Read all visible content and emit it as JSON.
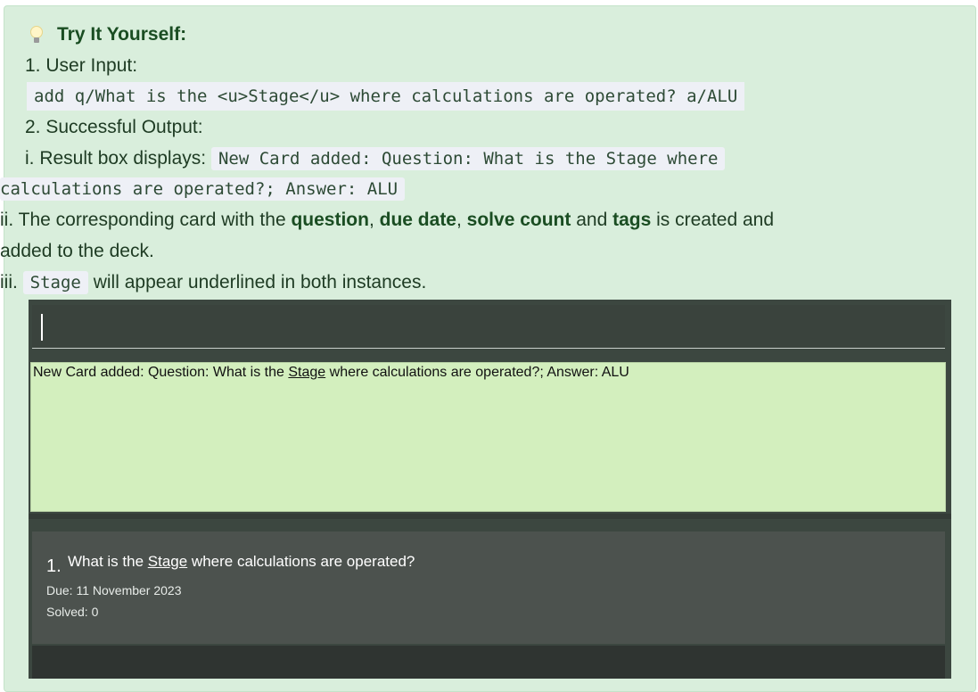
{
  "callout": {
    "title": "Try It Yourself:",
    "icon": "lightbulb-icon",
    "step1_label": "1. User Input:",
    "user_input": "add q/What is the <u>Stage</u> where calculations are operated? a/ALU",
    "step2_label": "2. Successful Output:",
    "step2_i_prefix": "i. Result box displays: ",
    "result_code_part1": "New Card added: Question: What is the Stage where",
    "result_code_part2": "calculations are operated?; Answer: ALU",
    "step2_ii_pre": "ii. The corresponding card with the ",
    "bold_question": "question",
    "comma1": ", ",
    "bold_due_date": "due date",
    "comma2": ", ",
    "bold_solve_count": "solve count",
    "and_word": " and ",
    "bold_tags": "tags",
    "step2_ii_post": " is created and",
    "step2_ii_line2": "added to the deck.",
    "step2_iii_prefix": "iii. ",
    "stage_code": "Stage",
    "step2_iii_suffix": " will appear underlined in both instances."
  },
  "app": {
    "result_prefix": "New Card added: Question: What is the ",
    "result_underlined": "Stage",
    "result_suffix": " where calculations are operated?; Answer: ALU",
    "card": {
      "index": "1.",
      "question_prefix": "What is the ",
      "question_underlined": "Stage",
      "question_suffix": " where calculations are operated?",
      "due": "Due: 11 November 2023",
      "solved": "Solved: 0"
    }
  },
  "colors": {
    "callout_bg": "#d9eedc",
    "text": "#1e3b23",
    "code_bg": "#eef0f6",
    "result_bg": "#d3efbe",
    "app_bg": "#3c4740",
    "card_bg": "#4c524e"
  }
}
